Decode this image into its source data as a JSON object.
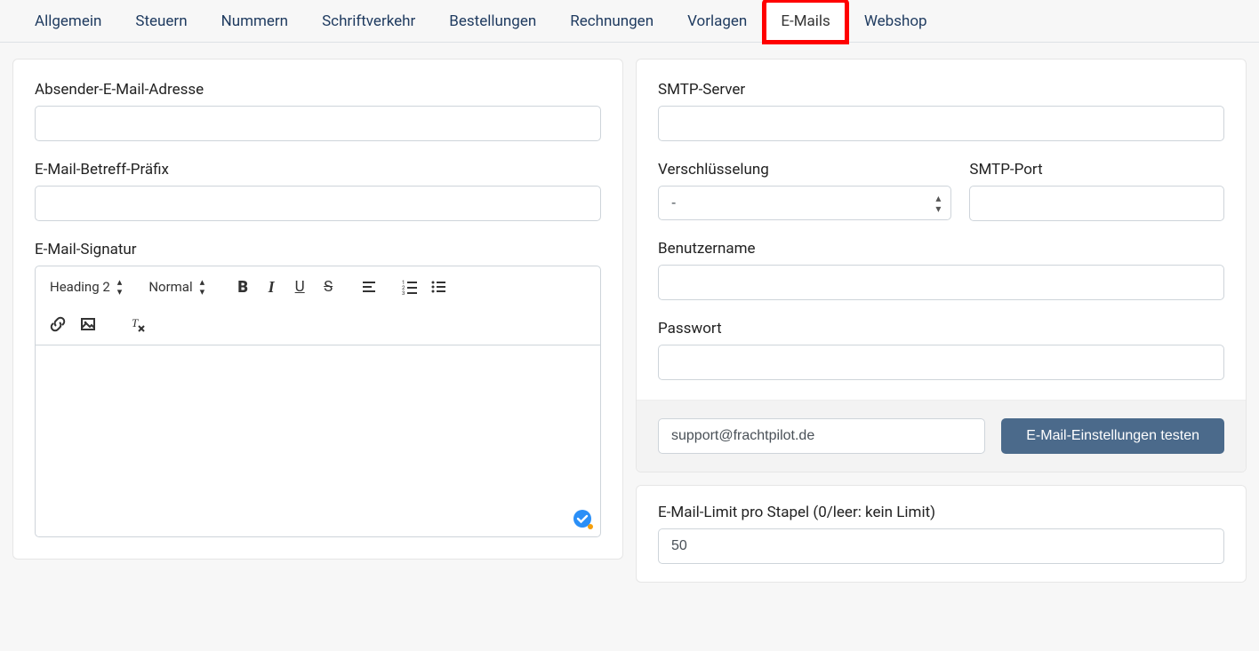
{
  "tabs": [
    {
      "label": "Allgemein"
    },
    {
      "label": "Steuern"
    },
    {
      "label": "Nummern"
    },
    {
      "label": "Schriftverkehr"
    },
    {
      "label": "Bestellungen"
    },
    {
      "label": "Rechnungen"
    },
    {
      "label": "Vorlagen"
    },
    {
      "label": "E-Mails",
      "active": true,
      "highlighted": true
    },
    {
      "label": "Webshop"
    }
  ],
  "left": {
    "sender_label": "Absender-E-Mail-Adresse",
    "sender_value": "",
    "prefix_label": "E-Mail-Betreff-Präfix",
    "prefix_value": "",
    "signature_label": "E-Mail-Signatur",
    "toolbar": {
      "heading": "Heading 2",
      "font_style": "Normal"
    }
  },
  "right": {
    "smtp_server_label": "SMTP-Server",
    "smtp_server_value": "",
    "encryption_label": "Verschlüsselung",
    "encryption_value": "-",
    "port_label": "SMTP-Port",
    "port_value": "",
    "username_label": "Benutzername",
    "username_value": "",
    "password_label": "Passwort",
    "password_value": "",
    "test_email_value": "support@frachtpilot.de",
    "test_button": "E-Mail-Einstellungen testen",
    "limit_label": "E-Mail-Limit pro Stapel (0/leer: kein Limit)",
    "limit_value": "50"
  }
}
